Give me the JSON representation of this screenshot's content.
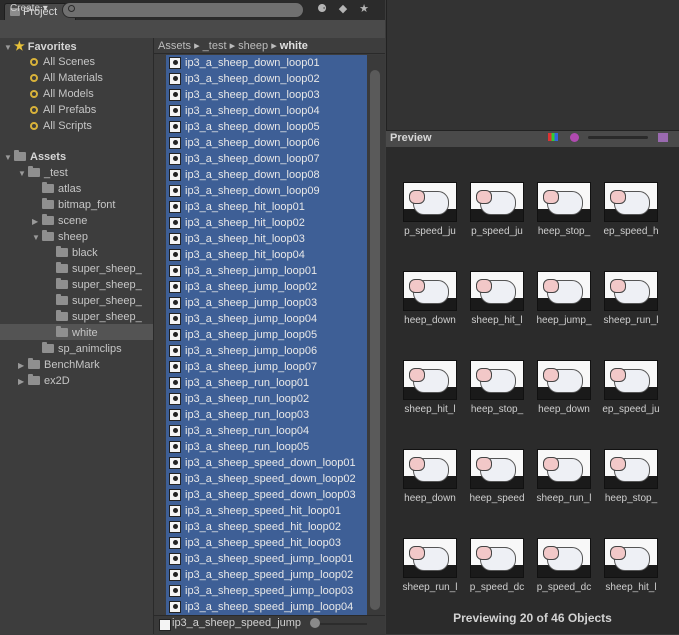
{
  "tab": {
    "title": "Project"
  },
  "toolbar": {
    "create_label": "Create ▾"
  },
  "tree": {
    "favorites_label": "Favorites",
    "favorites": [
      "All Scenes",
      "All Materials",
      "All Models",
      "All Prefabs",
      "All Scripts"
    ],
    "assets_label": "Assets",
    "folders": [
      {
        "label": "_test",
        "indent": 1,
        "arrow": "▼"
      },
      {
        "label": "atlas",
        "indent": 2,
        "arrow": ""
      },
      {
        "label": "bitmap_font",
        "indent": 2,
        "arrow": ""
      },
      {
        "label": "scene",
        "indent": 2,
        "arrow": "▶"
      },
      {
        "label": "sheep",
        "indent": 2,
        "arrow": "▼"
      },
      {
        "label": "black",
        "indent": 3,
        "arrow": ""
      },
      {
        "label": "super_sheep_",
        "indent": 3,
        "arrow": ""
      },
      {
        "label": "super_sheep_",
        "indent": 3,
        "arrow": ""
      },
      {
        "label": "super_sheep_",
        "indent": 3,
        "arrow": ""
      },
      {
        "label": "super_sheep_",
        "indent": 3,
        "arrow": ""
      },
      {
        "label": "white",
        "indent": 3,
        "arrow": ""
      },
      {
        "label": "sp_animclips",
        "indent": 2,
        "arrow": ""
      },
      {
        "label": "BenchMark",
        "indent": 1,
        "arrow": "▶"
      },
      {
        "label": "ex2D",
        "indent": 1,
        "arrow": "▶"
      }
    ]
  },
  "breadcrumb": {
    "items": [
      "Assets",
      "_test",
      "sheep"
    ],
    "current": "white"
  },
  "list": {
    "items": [
      "ip3_a_sheep_down_loop01",
      "ip3_a_sheep_down_loop02",
      "ip3_a_sheep_down_loop03",
      "ip3_a_sheep_down_loop04",
      "ip3_a_sheep_down_loop05",
      "ip3_a_sheep_down_loop06",
      "ip3_a_sheep_down_loop07",
      "ip3_a_sheep_down_loop08",
      "ip3_a_sheep_down_loop09",
      "ip3_a_sheep_hit_loop01",
      "ip3_a_sheep_hit_loop02",
      "ip3_a_sheep_hit_loop03",
      "ip3_a_sheep_hit_loop04",
      "ip3_a_sheep_jump_loop01",
      "ip3_a_sheep_jump_loop02",
      "ip3_a_sheep_jump_loop03",
      "ip3_a_sheep_jump_loop04",
      "ip3_a_sheep_jump_loop05",
      "ip3_a_sheep_jump_loop06",
      "ip3_a_sheep_jump_loop07",
      "ip3_a_sheep_run_loop01",
      "ip3_a_sheep_run_loop02",
      "ip3_a_sheep_run_loop03",
      "ip3_a_sheep_run_loop04",
      "ip3_a_sheep_run_loop05",
      "ip3_a_sheep_speed_down_loop01",
      "ip3_a_sheep_speed_down_loop02",
      "ip3_a_sheep_speed_down_loop03",
      "ip3_a_sheep_speed_hit_loop01",
      "ip3_a_sheep_speed_hit_loop02",
      "ip3_a_sheep_speed_hit_loop03",
      "ip3_a_sheep_speed_jump_loop01",
      "ip3_a_sheep_speed_jump_loop02",
      "ip3_a_sheep_speed_jump_loop03",
      "ip3_a_sheep_speed_jump_loop04"
    ],
    "bottom_item": "ip3_a_sheep_speed_jump"
  },
  "preview": {
    "title": "Preview",
    "captions": [
      "p_speed_ju",
      "p_speed_ju",
      "heep_stop_",
      "ep_speed_h",
      "heep_down",
      "sheep_hit_l",
      "heep_jump_",
      "sheep_run_l",
      "sheep_hit_l",
      "heep_stop_",
      "heep_down",
      "ep_speed_ju",
      "heep_down",
      "heep_speed",
      "sheep_run_l",
      "heep_stop_",
      "sheep_run_l",
      "p_speed_dc",
      "p_speed_dc",
      "sheep_hit_l"
    ],
    "footer": "Previewing 20 of 46 Objects"
  }
}
